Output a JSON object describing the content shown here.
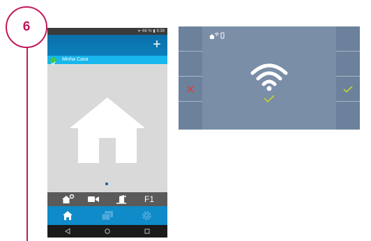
{
  "step": {
    "number": "6"
  },
  "phone": {
    "status_bar": {
      "text": "ᯤ 66 % ▮ 9:39"
    },
    "header": {
      "add_label": "+"
    },
    "home_row": {
      "label": "Minha Casa"
    },
    "action_bar": {
      "f1_label": "F1"
    },
    "tabs": [
      {
        "icon": "home-icon",
        "active": true
      },
      {
        "icon": "messages-icon",
        "active": false
      },
      {
        "icon": "gear-icon",
        "active": false
      }
    ],
    "nav": [
      "back-icon",
      "home-circle-icon",
      "recents-icon"
    ]
  },
  "monitor": {
    "status_icons": [
      "home-icon",
      "wifi-small-icon",
      "phone-icon"
    ],
    "left_buttons": [
      "",
      "",
      "close-icon",
      ""
    ],
    "right_buttons": [
      "",
      "",
      "check-icon",
      ""
    ]
  },
  "colors": {
    "accent": "#c2185b",
    "phone_header": "#0c7fbc",
    "home_row": "#17b6ec",
    "monitor_bg": "#7a8ea7",
    "reject": "#e53935",
    "accept": "#c8d42a"
  }
}
